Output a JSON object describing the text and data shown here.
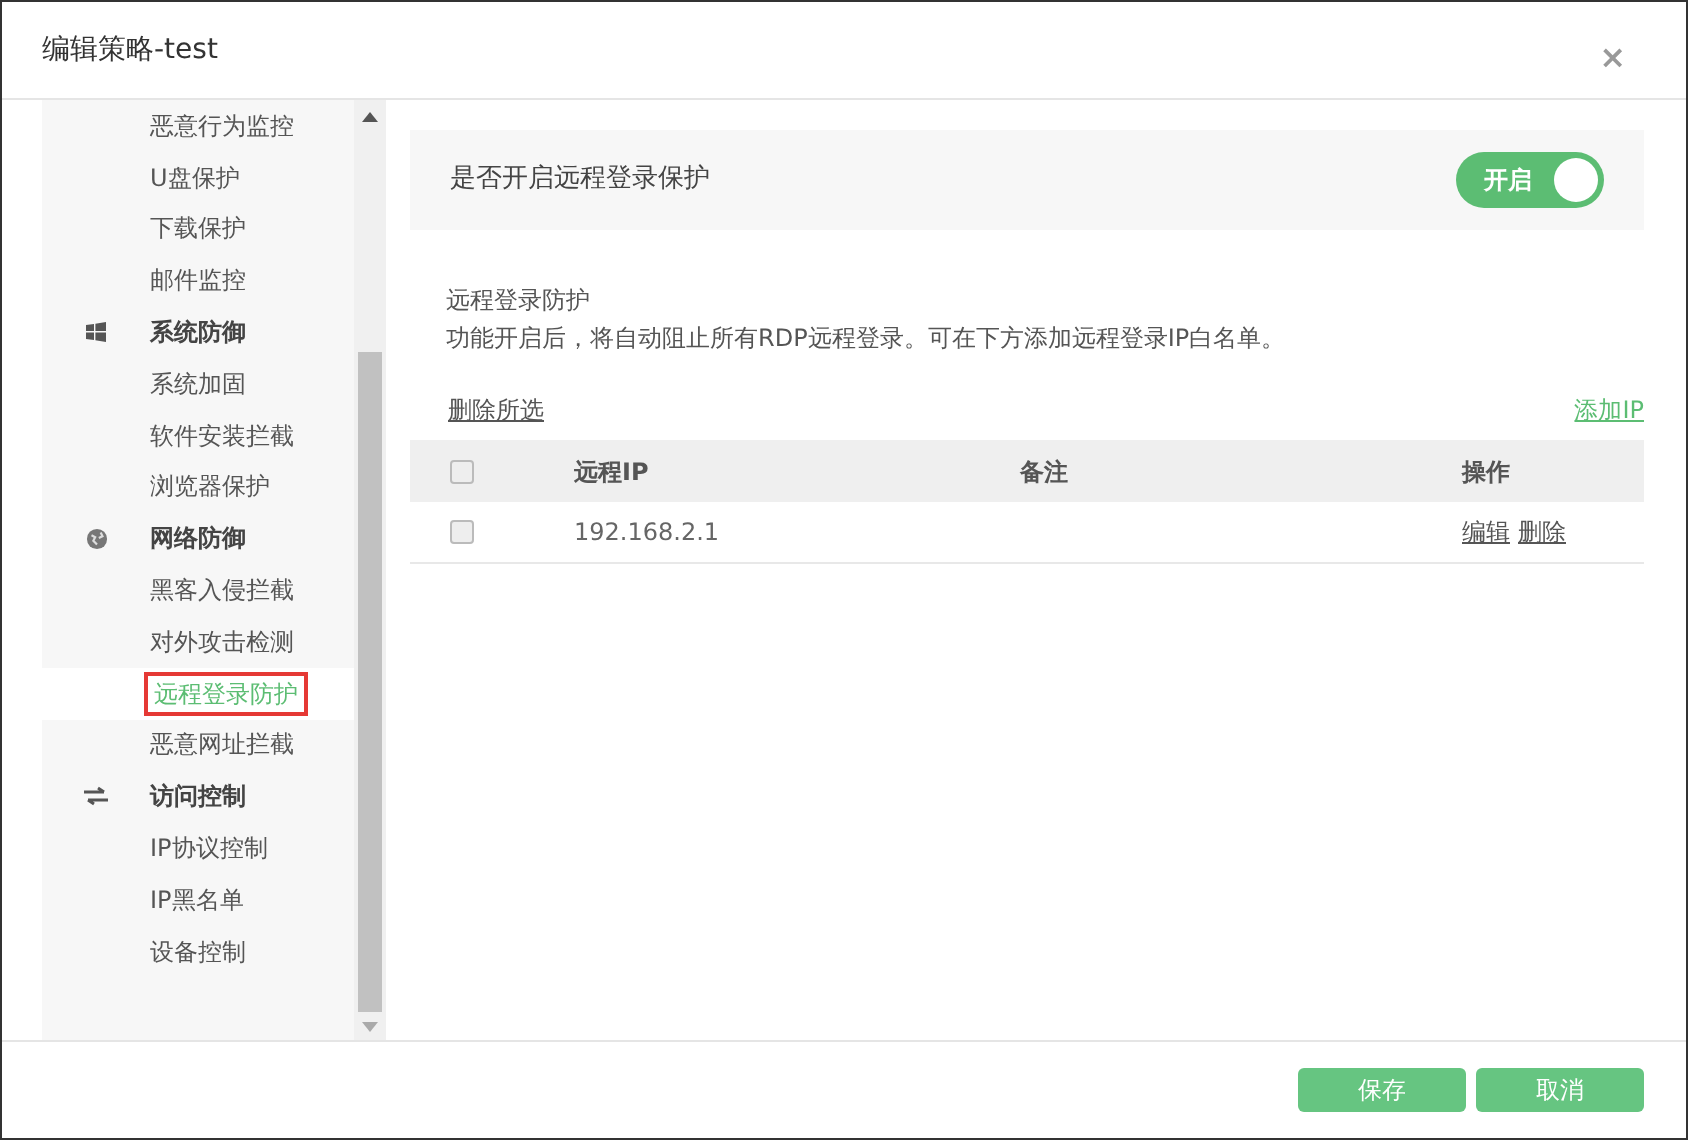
{
  "window": {
    "title": "编辑策略-test",
    "close": "×"
  },
  "sidebar": {
    "items": [
      {
        "kind": "item",
        "label": "恶意行为监控",
        "selected": false
      },
      {
        "kind": "item",
        "label": "U盘保护",
        "selected": false
      },
      {
        "kind": "item",
        "label": "下载保护",
        "selected": false
      },
      {
        "kind": "item",
        "label": "邮件监控",
        "selected": false
      },
      {
        "kind": "group",
        "label": "系统防御"
      },
      {
        "kind": "item",
        "label": "系统加固",
        "selected": false
      },
      {
        "kind": "item",
        "label": "软件安装拦截",
        "selected": false
      },
      {
        "kind": "item",
        "label": "浏览器保护",
        "selected": false
      },
      {
        "kind": "group",
        "label": "网络防御"
      },
      {
        "kind": "item",
        "label": "黑客入侵拦截",
        "selected": false
      },
      {
        "kind": "item",
        "label": "对外攻击检测",
        "selected": false
      },
      {
        "kind": "item",
        "label": "远程登录防护",
        "selected": true
      },
      {
        "kind": "item",
        "label": "恶意网址拦截",
        "selected": false
      },
      {
        "kind": "group",
        "label": "访问控制"
      },
      {
        "kind": "item",
        "label": "IP协议控制",
        "selected": false
      },
      {
        "kind": "item",
        "label": "IP黑名单",
        "selected": false
      },
      {
        "kind": "item",
        "label": "设备控制",
        "selected": false
      }
    ]
  },
  "toggle_row": {
    "label": "是否开启远程登录保护",
    "toggle_text": "开启",
    "on": true
  },
  "description": {
    "title": "远程登录防护",
    "text": "功能开启后，将自动阻止所有RDP远程登录。可在下方添加远程登录IP白名单。"
  },
  "actions": {
    "delete_selected": "删除所选",
    "add": "添加IP"
  },
  "table": {
    "header_checked": false,
    "columns": [
      "远程IP",
      "备注",
      "操作"
    ],
    "rows": [
      {
        "checked": false,
        "ip": "192.168.2.1",
        "note_actions": [
          "编辑",
          "删除"
        ]
      }
    ]
  },
  "buttons": [
    "保存",
    "取消"
  ]
}
